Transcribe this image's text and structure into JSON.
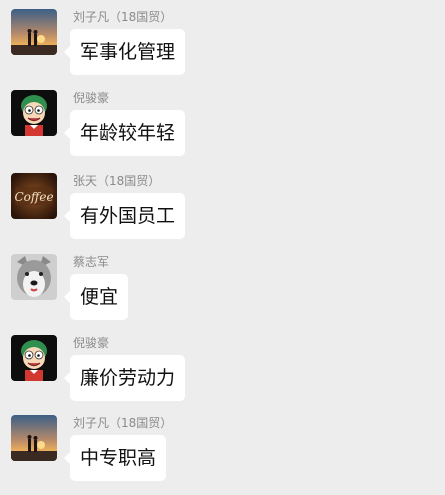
{
  "messages": [
    {
      "sender": "刘子凡（18国贸）",
      "text": "军事化管理",
      "avatar_icon": "sunset-couple-avatar-icon"
    },
    {
      "sender": "倪骏豪",
      "text": "年龄较年轻",
      "avatar_icon": "cartoon-boy-avatar-icon"
    },
    {
      "sender": "张天（18国贸）",
      "text": "有外国员工",
      "avatar_icon": "coffee-sign-avatar-icon"
    },
    {
      "sender": "蔡志军",
      "text": "便宜",
      "avatar_icon": "husky-dog-avatar-icon"
    },
    {
      "sender": "倪骏豪",
      "text": "廉价劳动力",
      "avatar_icon": "cartoon-boy-avatar-icon"
    },
    {
      "sender": "刘子凡（18国贸）",
      "text": "中专职高",
      "avatar_icon": "sunset-couple-avatar-icon"
    }
  ],
  "colors": {
    "background": "#ededed",
    "bubble": "#ffffff",
    "sender_name": "#8a8a8a",
    "message_text": "#111111"
  }
}
